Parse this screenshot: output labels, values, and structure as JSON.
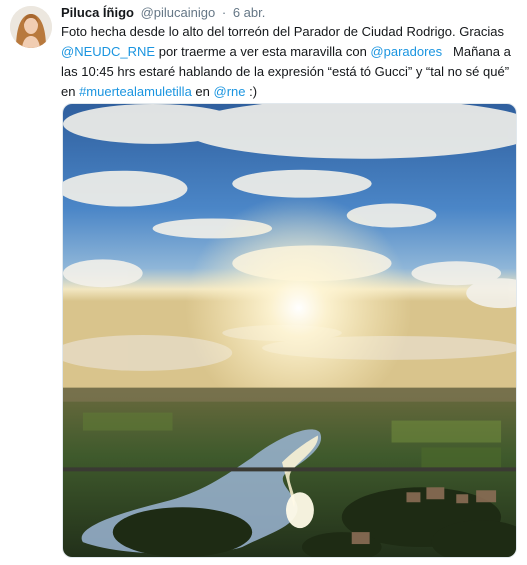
{
  "tweet": {
    "author_name": "Piluca Íñigo",
    "author_handle": "@pilucainigo",
    "separator": "·",
    "timestamp": "6 abr.",
    "text_1": "Foto hecha desde lo alto del torreón del Parador de Ciudad Rodrigo. Gracias ",
    "mention_1": "@NEUDC_RNE",
    "text_2": " por traerme a ver esta maravilla con ",
    "mention_2": "@paradores",
    "text_3": "   Mañana a las 10:45 hrs estaré hablando de la expresión “está tó Gucci” y “tal no sé qué” en ",
    "hashtag_1": "#muertealamuletilla",
    "text_4": " en ",
    "mention_3": "@rne",
    "text_5": " :)"
  },
  "colors": {
    "link": "#1b95e0",
    "secondary_text": "#657786",
    "primary_text": "#14171a"
  },
  "icons": {
    "avatar": "profile-photo"
  }
}
